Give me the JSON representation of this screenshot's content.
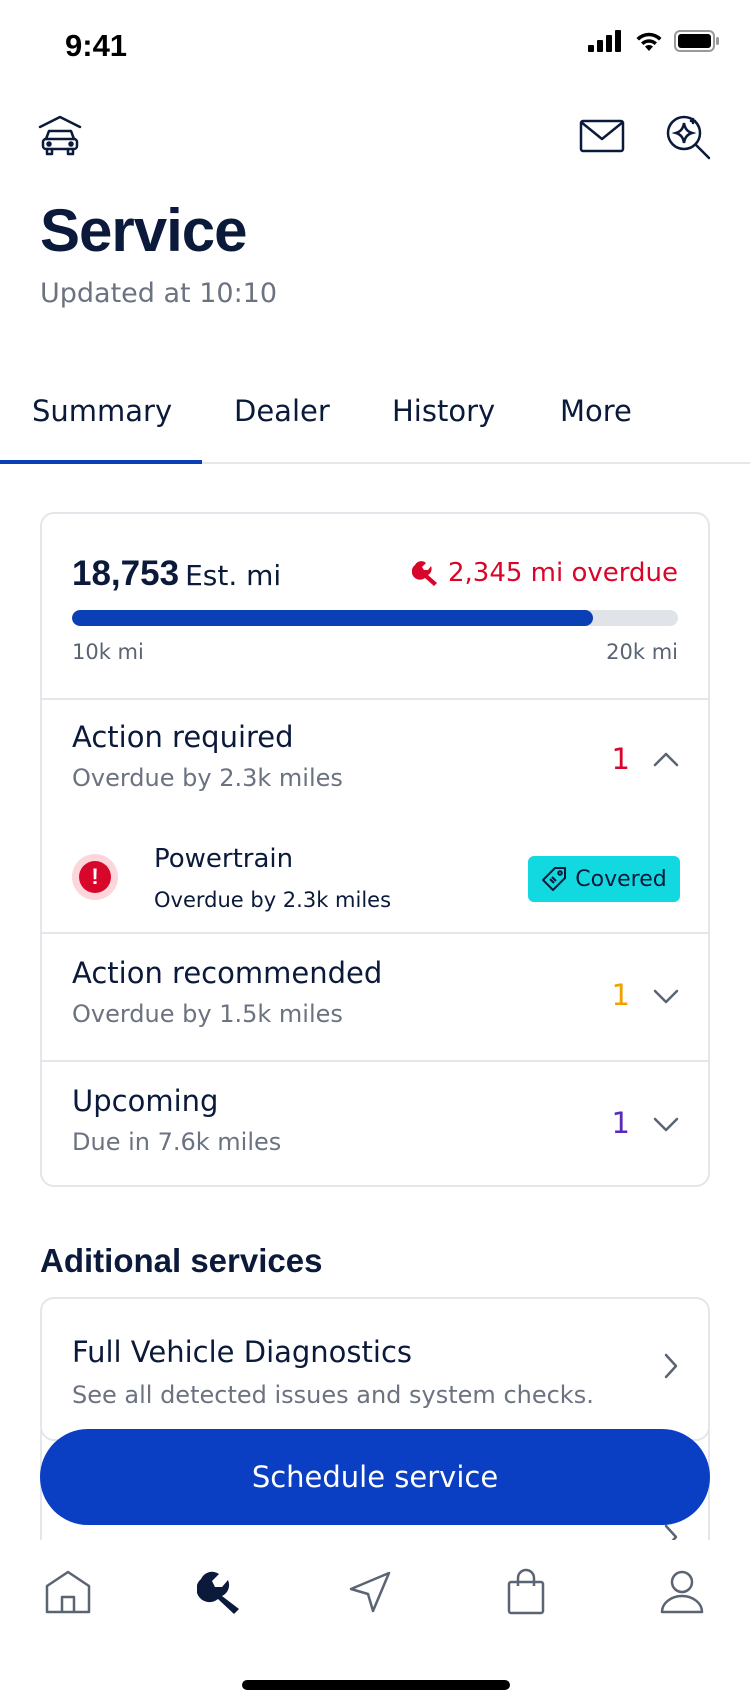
{
  "status_bar": {
    "time": "9:41"
  },
  "header": {
    "title": "Service",
    "updated": "Updated at 10:10"
  },
  "tabs": [
    {
      "label": "Summary",
      "active": true
    },
    {
      "label": "Dealer"
    },
    {
      "label": "History"
    },
    {
      "label": "More"
    }
  ],
  "mileage": {
    "value": "18,753",
    "unit": "Est. mi",
    "overdue": "2,345 mi overdue",
    "progress_fraction": 0.86,
    "range_min": "10k mi",
    "range_max": "20k mi"
  },
  "sections": {
    "action_required": {
      "title": "Action required",
      "subtitle": "Overdue by 2.3k miles",
      "count": "1",
      "color": "#d9062b"
    },
    "action_recommended": {
      "title": "Action recommended",
      "subtitle": "Overdue by 1.5k miles",
      "count": "1",
      "color": "#f0a000"
    },
    "upcoming": {
      "title": "Upcoming",
      "subtitle": "Due in 7.6k miles",
      "count": "1",
      "color": "#5a2ab8"
    }
  },
  "powertrain": {
    "title": "Powertrain",
    "subtitle": "Overdue by 2.3k miles",
    "badge": "Covered",
    "alert_glyph": "!"
  },
  "additional": {
    "title": "Aditional services",
    "items": [
      {
        "title": "Full Vehicle Diagnostics",
        "subtitle": "See all detected issues and system checks."
      }
    ]
  },
  "cta": {
    "label": "Schedule service"
  },
  "colors": {
    "brand": "#0a3fc4",
    "danger": "#d9062b",
    "covered": "#12d9e0"
  },
  "bottom_nav": [
    "home-icon",
    "wrench-icon",
    "navigation-icon",
    "shopping-bag-icon",
    "profile-icon"
  ]
}
